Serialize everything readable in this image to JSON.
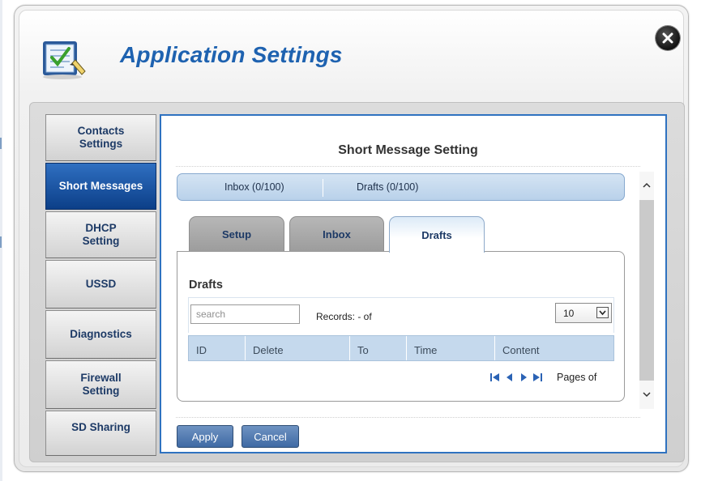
{
  "dialog": {
    "title": "Application Settings"
  },
  "sidebar": {
    "items": [
      {
        "label": "Contacts\nSettings"
      },
      {
        "label": "Short Messages"
      },
      {
        "label": "DHCP\nSetting"
      },
      {
        "label": "USSD"
      },
      {
        "label": "Diagnostics"
      },
      {
        "label": "Firewall\nSetting"
      },
      {
        "label": "SD Sharing"
      }
    ]
  },
  "main": {
    "heading": "Short Message Setting",
    "inbox_link": "Inbox (0/100)",
    "drafts_link": "Drafts (0/100)",
    "tabs": [
      {
        "label": "Setup"
      },
      {
        "label": "Inbox"
      },
      {
        "label": "Drafts"
      }
    ],
    "drafts": {
      "title": "Drafts",
      "search_placeholder": "search",
      "records": "Records: - of",
      "page_size": "10",
      "columns": [
        "ID",
        "Delete",
        "To",
        "Time",
        "Content"
      ],
      "pages": "Pages of"
    },
    "apply_label": "Apply",
    "cancel_label": "Cancel"
  },
  "icons": {
    "app": "settings-checklist-icon",
    "close": "close-icon",
    "pager": [
      "first-page-icon",
      "prev-page-icon",
      "next-page-icon",
      "last-page-icon"
    ]
  },
  "colors": {
    "title": "#1e62b0",
    "active_nav": "#0c3f88",
    "panel_border": "#2f72c0",
    "grid_header": "#c5d9ed"
  }
}
